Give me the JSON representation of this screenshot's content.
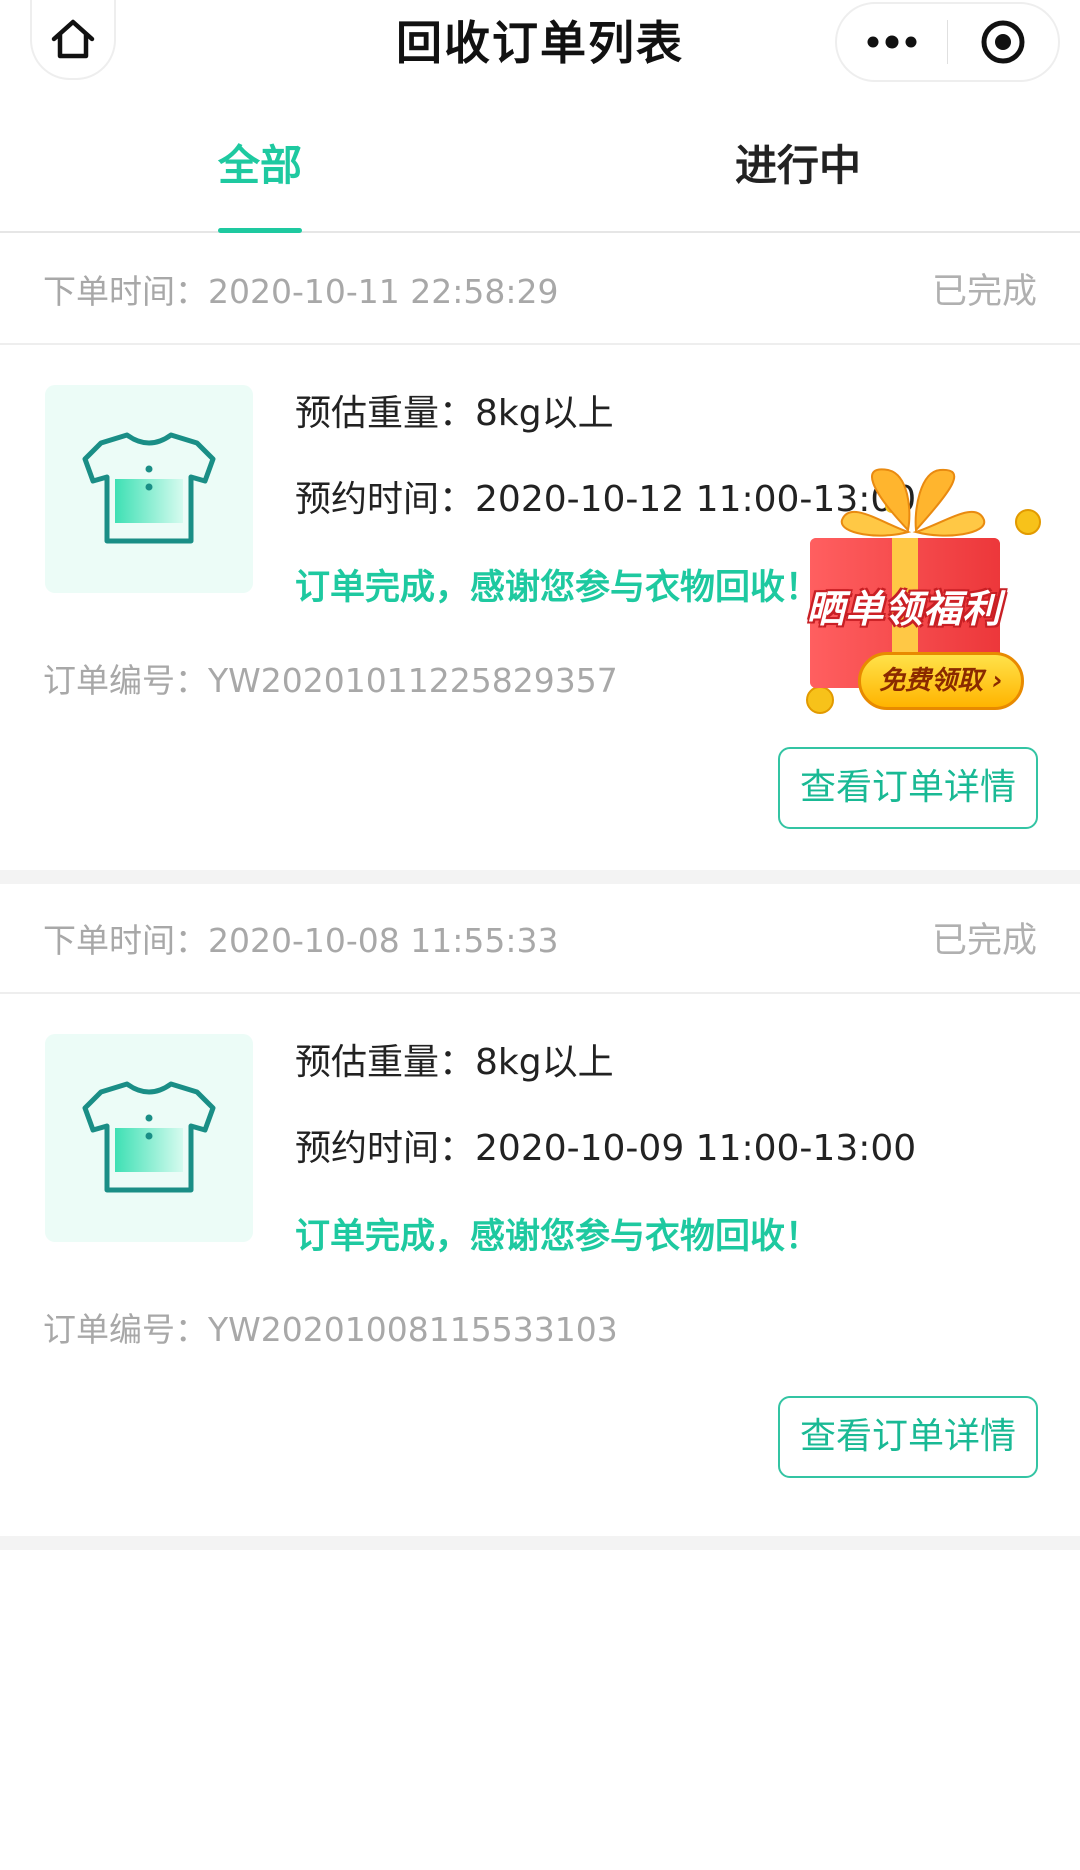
{
  "nav": {
    "title": "回收订单列表",
    "home_icon": "home-icon",
    "more_icon": "more-dots-icon",
    "close_icon": "target-close-icon"
  },
  "tabs": [
    {
      "label": "全部",
      "active": true
    },
    {
      "label": "进行中",
      "active": false
    }
  ],
  "colors": {
    "accent": "#1ec9a0",
    "muted_text": "#a8a8a8",
    "primary_text": "#222222"
  },
  "orders": [
    {
      "time_label": "下单时间：",
      "time": "2020-10-11 22:58:29",
      "status": "已完成",
      "weight_label": "预估重量：",
      "weight": "8kg以上",
      "appoint_label": "预约时间：",
      "appoint": "2020-10-12 11:00-13:00",
      "message": "订单完成，感谢您参与衣物回收！",
      "order_no_label": "订单编号：",
      "order_no": "YW20201011225829357",
      "detail_button": "查看订单详情"
    },
    {
      "time_label": "下单时间：",
      "time": "2020-10-08 11:55:33",
      "status": "已完成",
      "weight_label": "预估重量：",
      "weight": "8kg以上",
      "appoint_label": "预约时间：",
      "appoint": "2020-10-09 11:00-13:00",
      "message": "订单完成，感谢您参与衣物回收！",
      "order_no_label": "订单编号：",
      "order_no": "YW20201008115533103",
      "detail_button": "查看订单详情"
    }
  ],
  "gift_float": {
    "label": "晒单领福利",
    "button": "免费领取 ›",
    "icon": "gift-box-icon"
  }
}
